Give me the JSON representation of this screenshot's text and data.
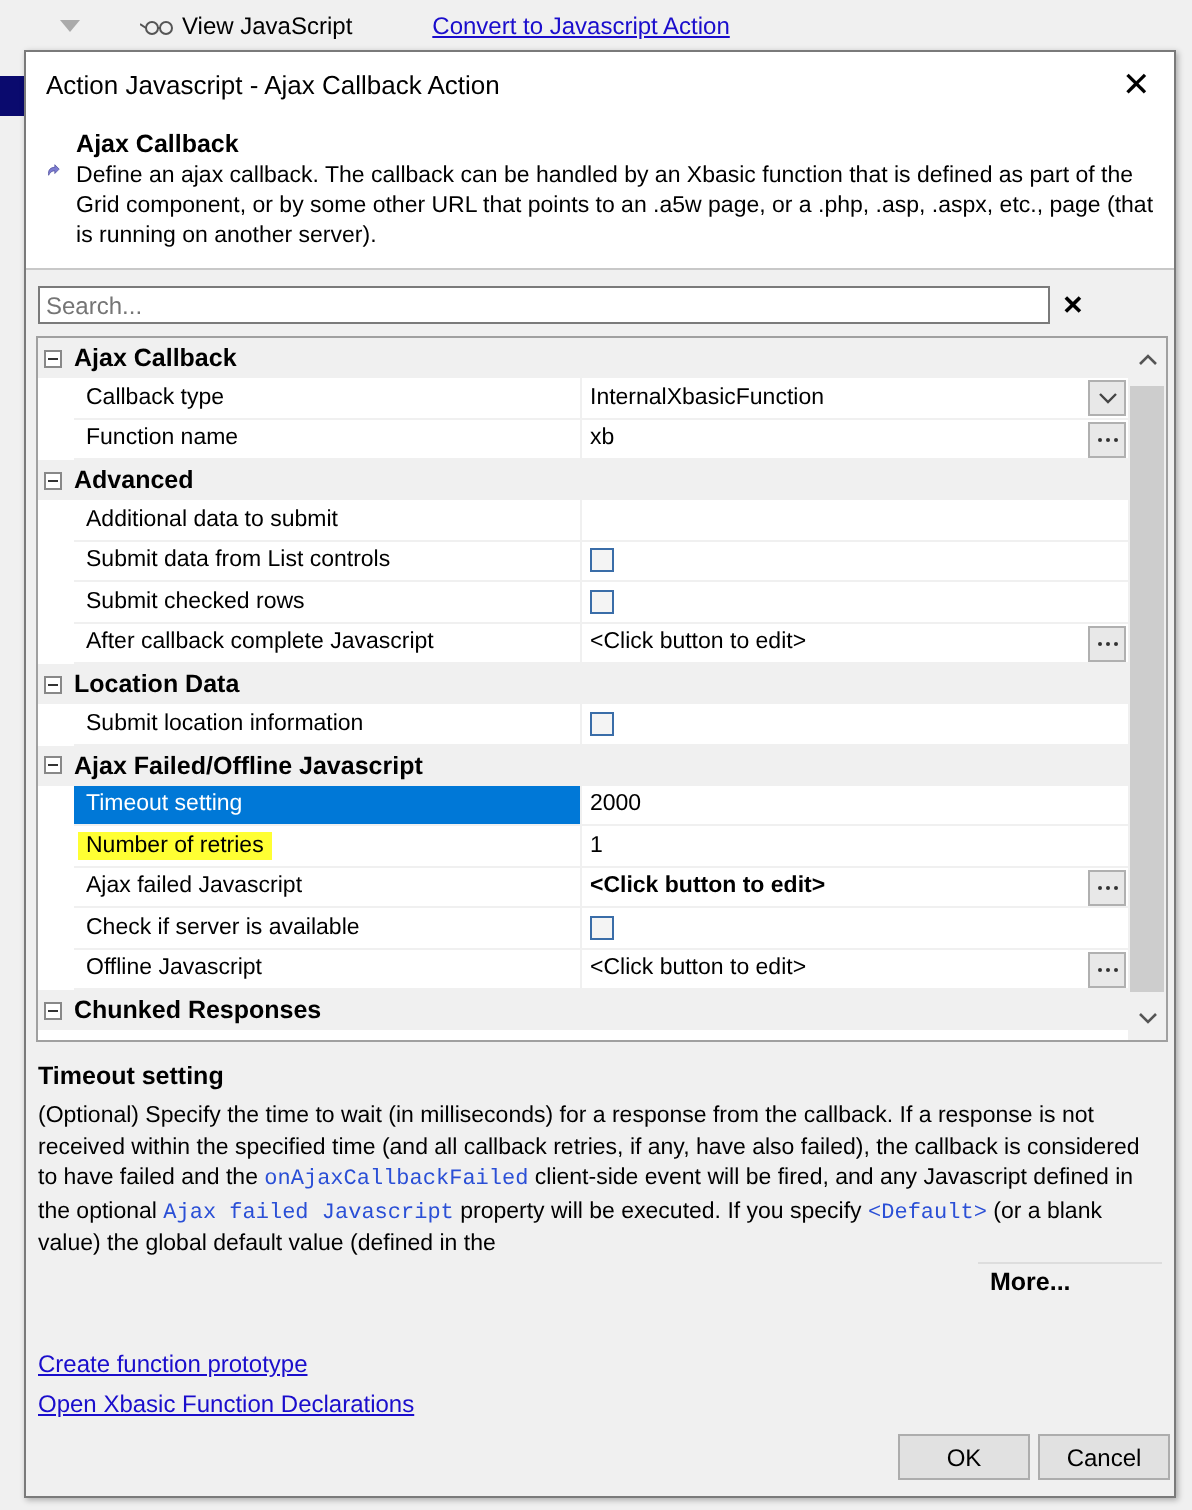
{
  "background": {
    "toolbar_item": "View JavaScript",
    "link": "Convert to Javascript Action"
  },
  "dialog": {
    "title": "Action Javascript - Ajax Callback Action",
    "close": "✕",
    "header": {
      "title": "Ajax Callback",
      "description": "Define an ajax callback. The callback can be handled by an Xbasic function that is defined as part of the Grid component, or by some other URL that points to an .a5w page, or a .php, .asp, .aspx, etc., page (that is running on another server)."
    },
    "search": {
      "placeholder": "Search...",
      "clear": "✕"
    },
    "properties": [
      {
        "title": "Ajax Callback",
        "expanded": true,
        "rows": [
          {
            "label": "Callback type",
            "value": "InternalXbasicFunction",
            "kind": "dropdown",
            "selected": false,
            "highlighted": false,
            "bold": false
          },
          {
            "label": "Function name",
            "value": "xb",
            "kind": "ellipsis",
            "selected": false,
            "highlighted": false,
            "bold": false
          }
        ]
      },
      {
        "title": "Advanced",
        "expanded": true,
        "rows": [
          {
            "label": "Additional data to submit",
            "kind": "text",
            "selected": false,
            "highlighted": false
          },
          {
            "label": "Submit data from List controls",
            "kind": "checkbox",
            "checked": false,
            "selected": false,
            "highlighted": false
          },
          {
            "label": "Submit checked rows",
            "kind": "checkbox",
            "checked": false,
            "selected": false,
            "highlighted": false
          },
          {
            "label": "After callback complete Javascript",
            "value": "<Click button to edit>",
            "kind": "ellipsis",
            "selected": false,
            "highlighted": false,
            "bold": false
          }
        ]
      },
      {
        "title": "Location Data",
        "expanded": true,
        "rows": [
          {
            "label": "Submit location information",
            "kind": "checkbox",
            "checked": false,
            "selected": false,
            "highlighted": false
          }
        ]
      },
      {
        "title": "Ajax Failed/Offline Javascript",
        "expanded": true,
        "rows": [
          {
            "label": "Timeout setting",
            "value": "2000",
            "kind": "text",
            "selected": true,
            "highlighted": false,
            "bold": false
          },
          {
            "label": "Number of retries",
            "value": "1",
            "kind": "text",
            "selected": false,
            "highlighted": true,
            "bold": false
          },
          {
            "label": "Ajax failed Javascript",
            "value": "<Click button to edit>",
            "kind": "ellipsis",
            "selected": false,
            "highlighted": false,
            "bold": true
          },
          {
            "label": "Check if server is available",
            "kind": "checkbox",
            "checked": false,
            "selected": false,
            "highlighted": false
          },
          {
            "label": "Offline Javascript",
            "value": "<Click button to edit>",
            "kind": "ellipsis",
            "selected": false,
            "highlighted": false,
            "bold": false
          }
        ]
      },
      {
        "title": "Chunked Responses",
        "expanded": true
      }
    ],
    "help": {
      "title": "Timeout setting",
      "segments": [
        {
          "kind": "text",
          "text": "(Optional) Specify the time to wait (in milliseconds) for a response from the callback. If a response is not received within the specified time (and all callback retries, if any, have also failed), the callback is considered to have failed and the "
        },
        {
          "kind": "code",
          "text": "onAjaxCallbackFailed"
        },
        {
          "kind": "text",
          "text": " client-side event will be fired, and any Javascript defined in the optional "
        },
        {
          "kind": "code",
          "text": "Ajax failed Javascript"
        },
        {
          "kind": "text",
          "text": " property will be executed. If you specify "
        },
        {
          "kind": "code",
          "text": "<Default>"
        },
        {
          "kind": "text",
          "text": " (or a blank value) the global default value (defined in the"
        }
      ],
      "more": "More..."
    },
    "links": [
      "Create function prototype",
      "Open Xbasic Function Declarations"
    ],
    "buttons": [
      "OK",
      "Cancel"
    ]
  }
}
